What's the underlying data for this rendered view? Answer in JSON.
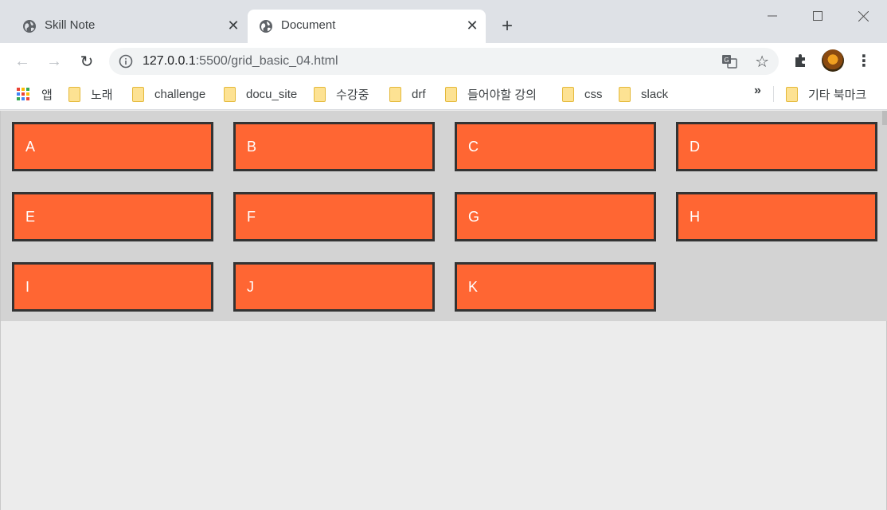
{
  "tabs": [
    {
      "title": "Skill Note",
      "active": false
    },
    {
      "title": "Document",
      "active": true
    }
  ],
  "address_bar": {
    "host": "127.0.0.1",
    "path": ":5500/grid_basic_04.html"
  },
  "bookmarks": [
    {
      "label": "앱",
      "icon": "apps-icon"
    },
    {
      "label": "노래",
      "icon": "folder-icon"
    },
    {
      "label": "challenge",
      "icon": "folder-icon"
    },
    {
      "label": "docu_site",
      "icon": "folder-icon"
    },
    {
      "label": "수강중",
      "icon": "folder-icon"
    },
    {
      "label": "drf",
      "icon": "folder-icon"
    },
    {
      "label": "들어야할 강의",
      "icon": "folder-icon"
    },
    {
      "label": "css",
      "icon": "folder-icon"
    },
    {
      "label": "slack",
      "icon": "folder-icon"
    }
  ],
  "bookmarks_overflow": "»",
  "other_bookmarks": "기타 북마크",
  "grid_items": [
    "A",
    "B",
    "C",
    "D",
    "E",
    "F",
    "G",
    "H",
    "I",
    "J",
    "K"
  ],
  "colors": {
    "item_bg": "#ff6633",
    "item_border": "#333333",
    "container_bg": "#d3d3d3",
    "page_bg": "#ececec"
  }
}
